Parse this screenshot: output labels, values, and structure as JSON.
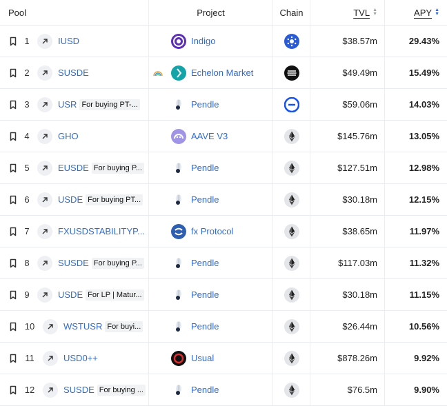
{
  "headers": {
    "pool": "Pool",
    "project": "Project",
    "chain": "Chain",
    "tvl": "TVL",
    "apy": "APY"
  },
  "colors": {
    "link": "#2f6bd8",
    "sort_active": "#2f6bd8"
  },
  "rows": [
    {
      "rank": "1",
      "pool": "IUSD",
      "tag": "",
      "project": "Indigo",
      "project_icon": "indigo-logo-icon",
      "chain_icon": "cardano-icon",
      "tvl": "$38.57m",
      "apy": "29.43%"
    },
    {
      "rank": "2",
      "pool": "SUSDE",
      "tag": "",
      "project": "Echelon Market",
      "project_icon": "echelon-logo-icon",
      "chain_icon": "aptos-icon",
      "tvl": "$49.49m",
      "apy": "15.49%"
    },
    {
      "rank": "3",
      "pool": "USR",
      "tag": "For buying PT-...",
      "project": "Pendle",
      "project_icon": "pendle-logo-icon",
      "chain_icon": "base-icon",
      "tvl": "$59.06m",
      "apy": "14.03%"
    },
    {
      "rank": "4",
      "pool": "GHO",
      "tag": "",
      "project": "AAVE V3",
      "project_icon": "aave-logo-icon",
      "chain_icon": "ethereum-icon",
      "tvl": "$145.76m",
      "apy": "13.05%"
    },
    {
      "rank": "5",
      "pool": "EUSDE",
      "tag": "For buying P...",
      "project": "Pendle",
      "project_icon": "pendle-logo-icon",
      "chain_icon": "ethereum-icon",
      "tvl": "$127.51m",
      "apy": "12.98%"
    },
    {
      "rank": "6",
      "pool": "USDE",
      "tag": "For buying PT...",
      "project": "Pendle",
      "project_icon": "pendle-logo-icon",
      "chain_icon": "ethereum-icon",
      "tvl": "$30.18m",
      "apy": "12.15%"
    },
    {
      "rank": "7",
      "pool": "FXUSDSTABILITYP...",
      "tag": "",
      "project": "fx Protocol",
      "project_icon": "fx-protocol-logo-icon",
      "chain_icon": "ethereum-icon",
      "tvl": "$38.65m",
      "apy": "11.97%"
    },
    {
      "rank": "8",
      "pool": "SUSDE",
      "tag": "For buying P...",
      "project": "Pendle",
      "project_icon": "pendle-logo-icon",
      "chain_icon": "ethereum-icon",
      "tvl": "$117.03m",
      "apy": "11.32%"
    },
    {
      "rank": "9",
      "pool": "USDE",
      "tag": "For LP | Matur...",
      "project": "Pendle",
      "project_icon": "pendle-logo-icon",
      "chain_icon": "ethereum-icon",
      "tvl": "$30.18m",
      "apy": "11.15%"
    },
    {
      "rank": "10",
      "pool": "WSTUSR",
      "tag": "For buyi...",
      "project": "Pendle",
      "project_icon": "pendle-logo-icon",
      "chain_icon": "ethereum-icon",
      "tvl": "$26.44m",
      "apy": "10.56%"
    },
    {
      "rank": "11",
      "pool": "USD0++",
      "tag": "",
      "project": "Usual",
      "project_icon": "usual-logo-icon",
      "chain_icon": "ethereum-icon",
      "tvl": "$878.26m",
      "apy": "9.92%"
    },
    {
      "rank": "12",
      "pool": "SUSDE",
      "tag": "For buying ...",
      "project": "Pendle",
      "project_icon": "pendle-logo-icon",
      "chain_icon": "ethereum-icon",
      "tvl": "$76.5m",
      "apy": "9.90%"
    }
  ]
}
